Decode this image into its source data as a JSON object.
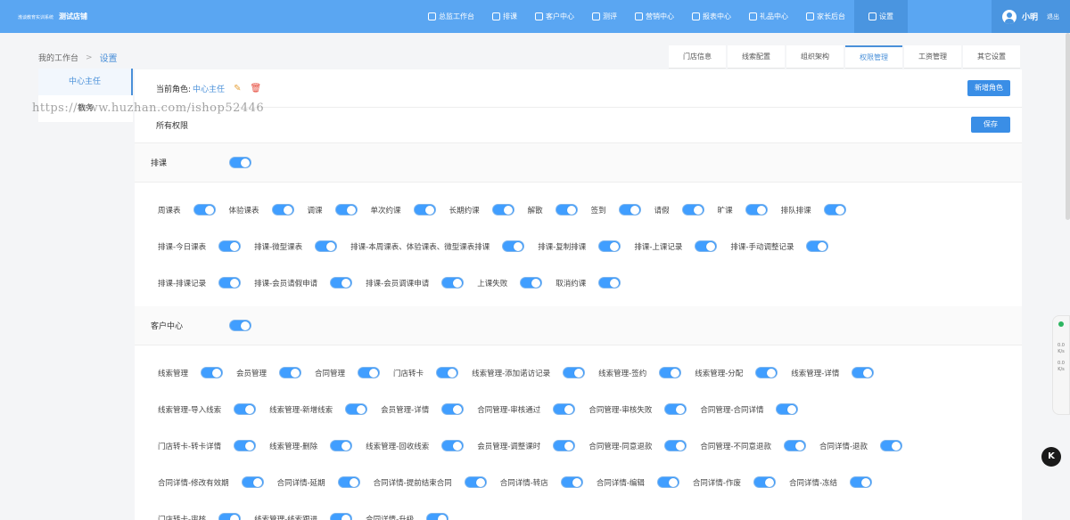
{
  "header": {
    "brand_small": "渤谈教育实训系统",
    "store_name": "测试店铺",
    "nav": [
      "总监工作台",
      "排课",
      "客户中心",
      "测评",
      "营销中心",
      "报表中心",
      "礼品中心",
      "家长后台",
      "设置"
    ],
    "user_name": "小明",
    "logout": "退出"
  },
  "breadcrumb": {
    "home": "我的工作台",
    "sep": ">",
    "current": "设置"
  },
  "tabs": [
    "门店信息",
    "线索配置",
    "组织架构",
    "权限管理",
    "工资管理",
    "其它设置"
  ],
  "sidebar": [
    "中心主任",
    "教务"
  ],
  "role": {
    "label": "当前角色:",
    "name": "中心主任",
    "add_button": "新增角色",
    "all_permissions": "所有权限",
    "save_button": "保存"
  },
  "watermark": "https://www.huzhan.com/ishop52446",
  "sections": [
    {
      "title": "排课",
      "rows": [
        [
          "周课表",
          "体验课表",
          "调课",
          "单次约课",
          "长期约课",
          "解散",
          "签到",
          "请假",
          "旷课",
          "排队排课"
        ],
        [
          "排课-今日课表",
          "排课-微型课表",
          "排课-本周课表、体验课表、微型课表排课",
          "排课-复制排课",
          "排课-上课记录",
          "排课-手动调整记录"
        ],
        [
          "排课-排课记录",
          "排课-会员请假申请",
          "排课-会员调课申请",
          "上课失败",
          "取消约课"
        ]
      ]
    },
    {
      "title": "客户中心",
      "rows": [
        [
          "线索管理",
          "会员管理",
          "合同管理",
          "门店转卡",
          "线索管理-添加诺访记录",
          "线索管理-签约",
          "线索管理-分配",
          "线索管理-详情"
        ],
        [
          "线索管理-导入线索",
          "线索管理-新增线索",
          "会员管理-详情",
          "合同管理-审核通过",
          "合同管理-审核失败",
          "合同管理-合同详情"
        ],
        [
          "门店转卡-转卡详情",
          "线索管理-删除",
          "线索管理-回收线索",
          "会员管理-调整课时",
          "合同管理-同意退款",
          "合同管理-不同意退款",
          "合同详情-退款"
        ],
        [
          "合同详情-修改有效期",
          "合同详情-延期",
          "合同详情-提前结束合同",
          "合同详情-转店",
          "合同详情-编辑",
          "合同详情-作废",
          "合同详情-冻结"
        ],
        [
          "门店转卡-审核",
          "线索管理-线索跟进",
          "合同详情-升级"
        ]
      ]
    }
  ],
  "float_panel": {
    "val1": "0.0",
    "unit1": "K/s",
    "val2": "0.0",
    "unit2": "K/s"
  },
  "badge": "K",
  "colors": {
    "primary": "#5aa6f2",
    "accent": "#409eff",
    "active_text": "#4a90d9"
  }
}
